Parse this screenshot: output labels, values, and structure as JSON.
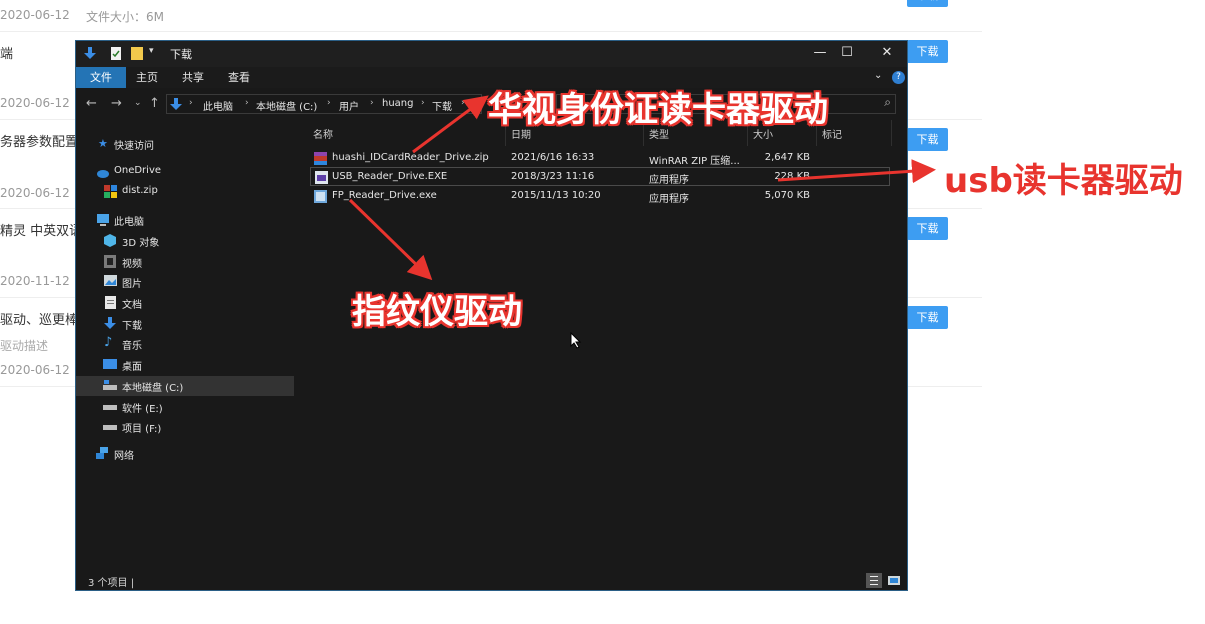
{
  "background": {
    "dates": [
      "2020-06-12",
      "2020-06-12",
      "2020-06-12",
      "2020-11-12",
      "2020-06-12"
    ],
    "file_size": "文件大小：6M",
    "titles": [
      "端",
      "务器参数配置",
      "精灵 中英双语",
      "驱动、巡更棒"
    ],
    "desc": "驱动描述",
    "download_label": "下载"
  },
  "window": {
    "title": "下载",
    "controls": {
      "minimize": "—",
      "maximize": "☐",
      "close": "✕"
    },
    "ribbon_tabs": [
      "文件",
      "主页",
      "共享",
      "查看"
    ],
    "help": "?",
    "breadcrumb": [
      "此电脑",
      "本地磁盘 (C:)",
      "用户",
      "huang",
      "下载"
    ],
    "sidebar": [
      {
        "label": "快速访问",
        "icon": "star-icon"
      },
      {
        "label": "OneDrive",
        "icon": "cloud-icon"
      },
      {
        "label": "dist.zip",
        "icon": "zip-icon"
      },
      {
        "label": "此电脑",
        "icon": "computer-icon"
      },
      {
        "label": "3D 对象",
        "icon": "cube-icon"
      },
      {
        "label": "视频",
        "icon": "video-icon"
      },
      {
        "label": "图片",
        "icon": "picture-icon"
      },
      {
        "label": "文档",
        "icon": "document-icon"
      },
      {
        "label": "下载",
        "icon": "download-icon"
      },
      {
        "label": "音乐",
        "icon": "music-icon"
      },
      {
        "label": "桌面",
        "icon": "desktop-icon"
      },
      {
        "label": "本地磁盘 (C:)",
        "icon": "drive-c-icon"
      },
      {
        "label": "软件 (E:)",
        "icon": "drive-icon"
      },
      {
        "label": "项目 (F:)",
        "icon": "drive-icon"
      },
      {
        "label": "网络",
        "icon": "network-icon"
      }
    ],
    "columns": [
      "名称",
      "日期",
      "类型",
      "大小",
      "标记"
    ],
    "files": [
      {
        "name": "huashi_IDCardReader_Drive.zip",
        "date": "2021/6/16 16:33",
        "type": "WinRAR ZIP 压缩...",
        "size": "2,647 KB",
        "icon": "rar-archive-icon"
      },
      {
        "name": "USB_Reader_Drive.EXE",
        "date": "2018/3/23 11:16",
        "type": "应用程序",
        "size": "228 KB",
        "icon": "exe-icon"
      },
      {
        "name": "FP_Reader_Drive.exe",
        "date": "2015/11/13 10:20",
        "type": "应用程序",
        "size": "5,070 KB",
        "icon": "exe-icon"
      }
    ],
    "status": "3 个项目  |"
  },
  "annotations": {
    "idcard": "华视身份证读卡器驱动",
    "usb": "usb读卡器驱动",
    "fingerprint": "指纹仪驱动"
  },
  "colors": {
    "accent": "#2474b5",
    "annotation": "#e8342e",
    "download_button": "#3d9df2"
  }
}
